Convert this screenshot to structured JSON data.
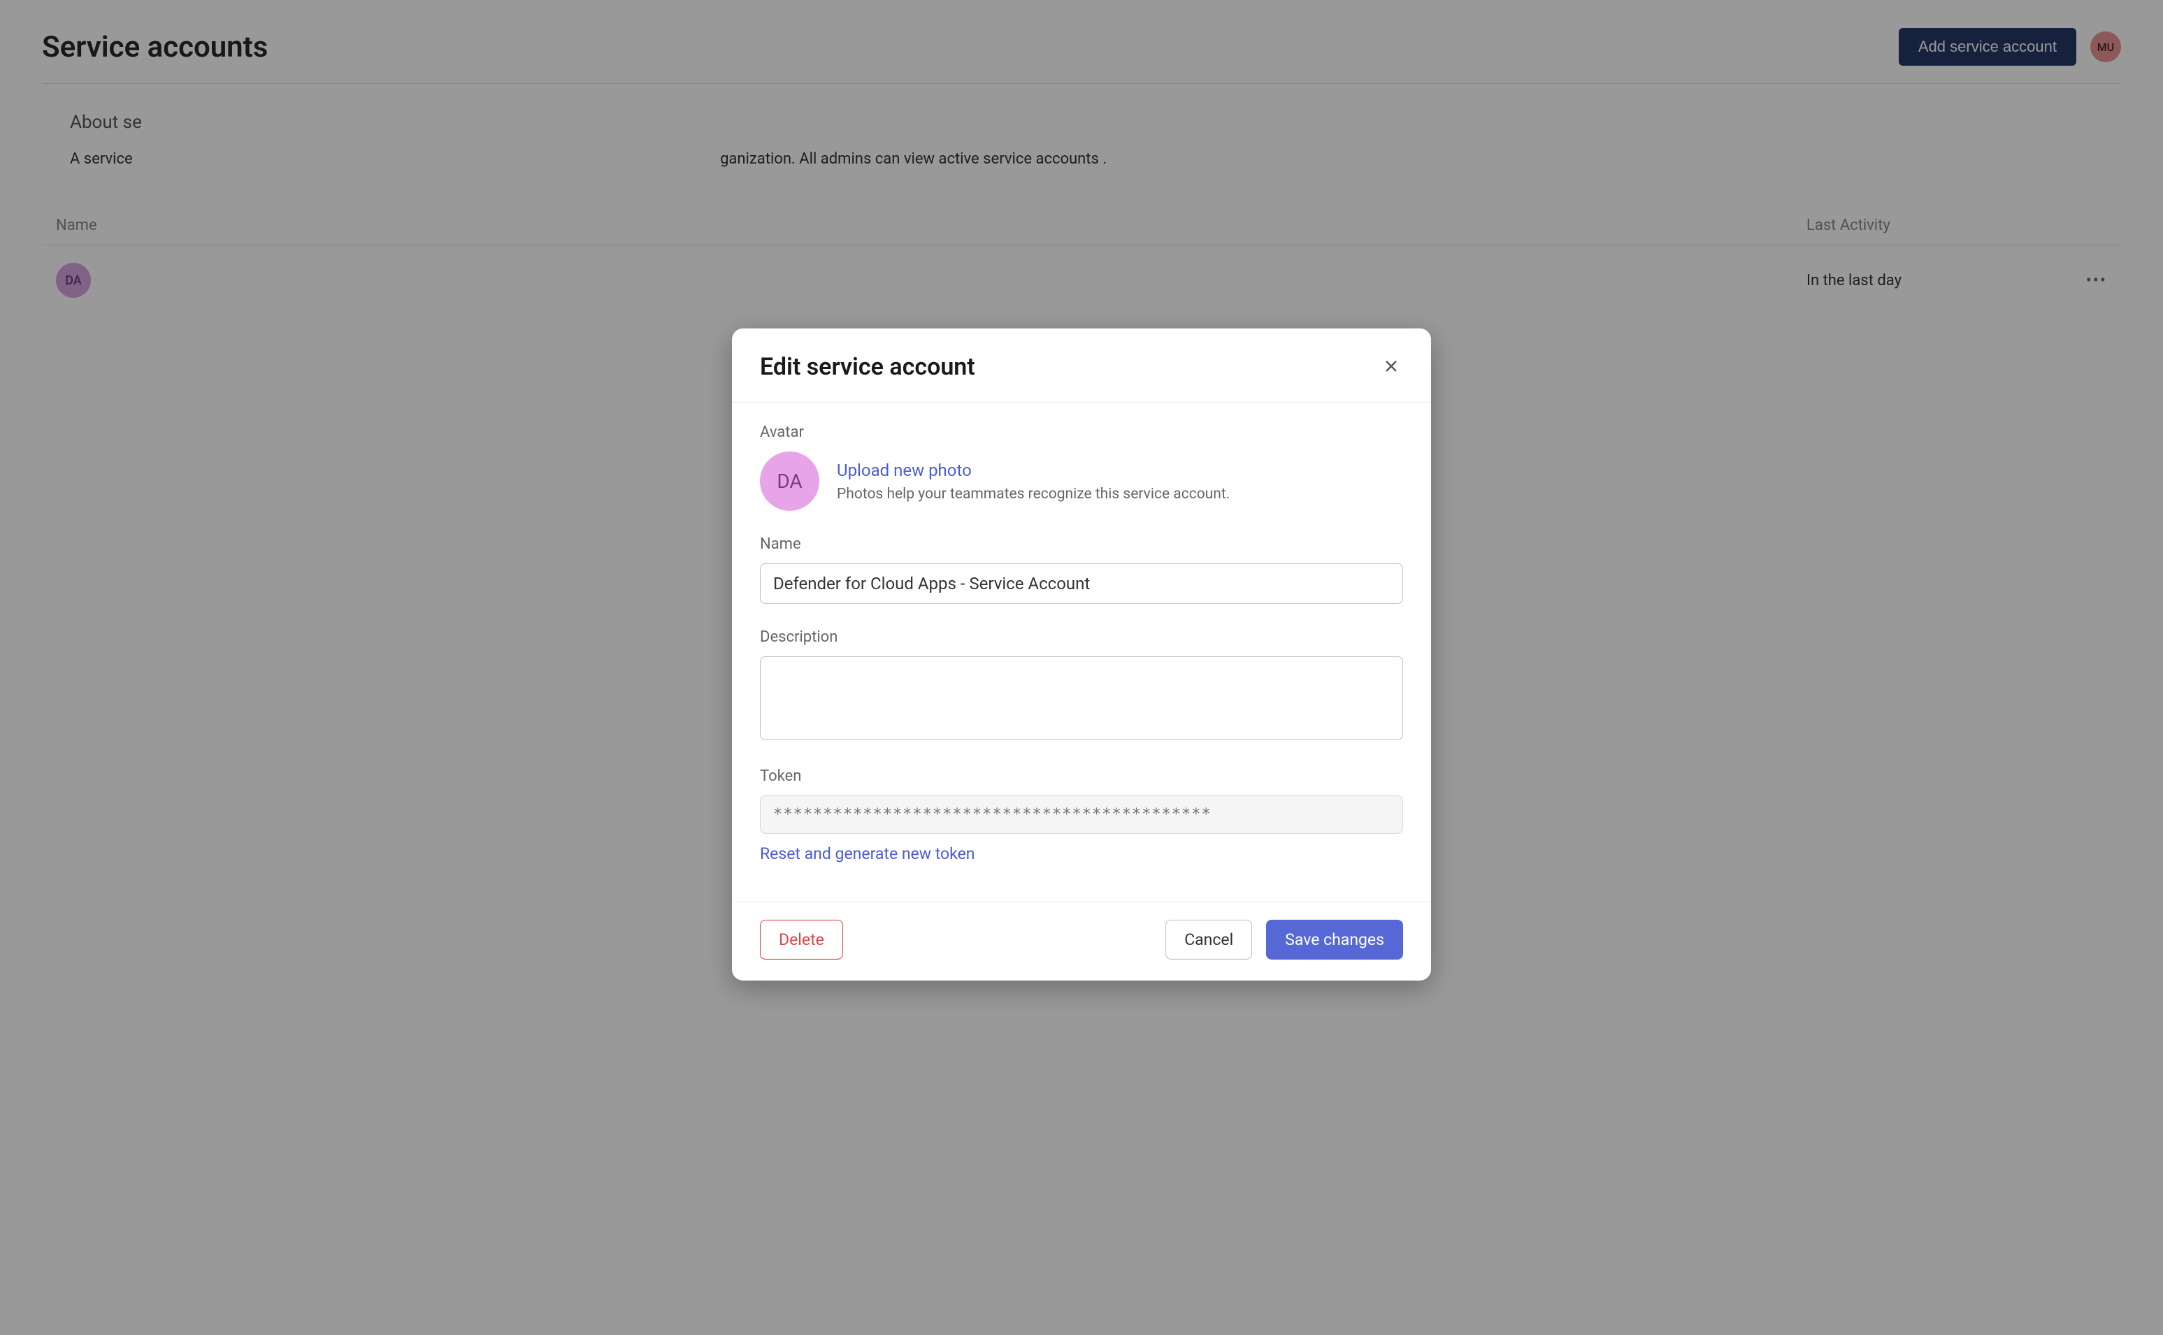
{
  "page": {
    "title": "Service accounts",
    "add_button": "Add service account",
    "user_initials": "MU",
    "section_title_prefix": "About se",
    "section_desc_prefix": "A service ",
    "section_desc_suffix": "ganization. All admins can view active service accounts ."
  },
  "table": {
    "col_name": "Name",
    "col_activity": "Last Activity",
    "rows": [
      {
        "avatar_initials": "DA",
        "activity": "In the last day"
      }
    ]
  },
  "modal": {
    "title": "Edit service account",
    "avatar": {
      "label": "Avatar",
      "initials": "DA",
      "upload_link": "Upload new photo",
      "hint": "Photos help your teammates recognize this service account."
    },
    "name": {
      "label": "Name",
      "value": "Defender for Cloud Apps - Service Account"
    },
    "description": {
      "label": "Description",
      "value": ""
    },
    "token": {
      "label": "Token",
      "value": "********************************************",
      "reset_link": "Reset and generate new token"
    },
    "footer": {
      "delete": "Delete",
      "cancel": "Cancel",
      "save": "Save changes"
    }
  }
}
